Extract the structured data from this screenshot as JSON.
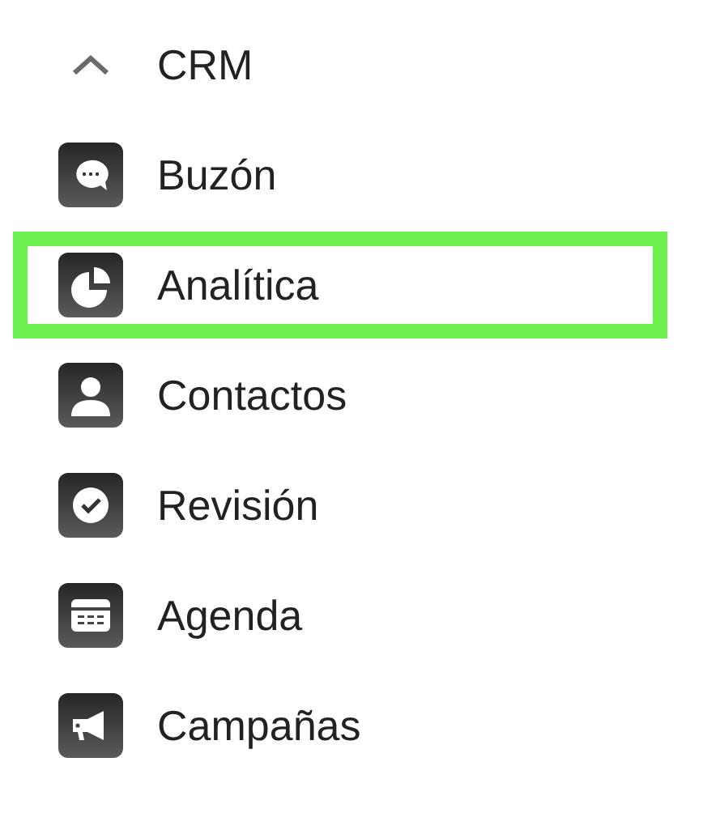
{
  "section": {
    "title": "CRM",
    "expanded": true
  },
  "items": [
    {
      "label": "Buzón",
      "selected": false
    },
    {
      "label": "Analítica",
      "selected": true
    },
    {
      "label": "Contactos",
      "selected": false
    },
    {
      "label": "Revisión",
      "selected": false
    },
    {
      "label": "Agenda",
      "selected": false
    },
    {
      "label": "Campañas",
      "selected": false
    }
  ]
}
